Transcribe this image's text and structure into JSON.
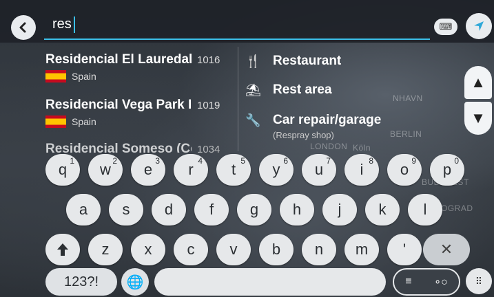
{
  "search": {
    "query": "res"
  },
  "results": [
    {
      "name": "Residencial El Lauredal (",
      "distance": "1016",
      "country": "Spain"
    },
    {
      "name": "Residencial Vega Park II",
      "distance": "1019",
      "country": "Spain"
    },
    {
      "name": "Residencial Someso (Cor",
      "distance": "1034",
      "country": ""
    }
  ],
  "categories": [
    {
      "label": "Restaurant",
      "sub": "",
      "icon": "fork-knife-icon"
    },
    {
      "label": "Rest area",
      "sub": "",
      "icon": "rest-area-icon"
    },
    {
      "label": "Car repair/garage",
      "sub": "(Respray shop)",
      "icon": "wrench-icon"
    }
  ],
  "map_labels": [
    "NHAVN",
    "BERLIN",
    "LONDON",
    "Köln",
    "BUDAPEST",
    "OGRAD"
  ],
  "keyboard": {
    "row1": [
      {
        "key": "q",
        "num": "1"
      },
      {
        "key": "w",
        "num": "2"
      },
      {
        "key": "e",
        "num": "3"
      },
      {
        "key": "r",
        "num": "4"
      },
      {
        "key": "t",
        "num": "5"
      },
      {
        "key": "y",
        "num": "6"
      },
      {
        "key": "u",
        "num": "7"
      },
      {
        "key": "i",
        "num": "8"
      },
      {
        "key": "o",
        "num": "9"
      },
      {
        "key": "p",
        "num": "0"
      }
    ],
    "row2": [
      "a",
      "s",
      "d",
      "f",
      "g",
      "h",
      "j",
      "k",
      "l"
    ],
    "row3": [
      "z",
      "x",
      "c",
      "v",
      "b",
      "n",
      "m",
      "'"
    ],
    "numeric_label": "123?!"
  },
  "colors": {
    "accent": "#3bbfe8",
    "flag_red": "#c60b1e",
    "flag_yellow": "#ffc400"
  }
}
